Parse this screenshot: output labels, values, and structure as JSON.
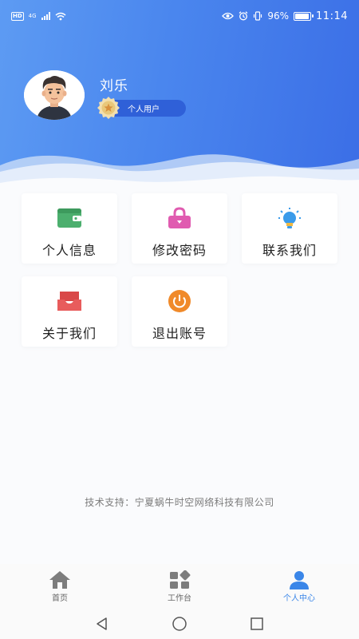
{
  "status_bar": {
    "hd": "HD",
    "network": "4G",
    "battery": "96%",
    "battery_level": 0.96,
    "time": "11:14"
  },
  "profile": {
    "name": "刘乐",
    "badge": "个人用户"
  },
  "menu": [
    {
      "label": "个人信息",
      "icon": "wallet-icon",
      "color": "#4caf6e"
    },
    {
      "label": "修改密码",
      "icon": "lock-icon",
      "color": "#e05bb0"
    },
    {
      "label": "联系我们",
      "icon": "bulb-icon",
      "color": "#3a9bea"
    },
    {
      "label": "关于我们",
      "icon": "inbox-icon",
      "color": "#e85c5c"
    },
    {
      "label": "退出账号",
      "icon": "power-icon",
      "color": "#f08a2a"
    }
  ],
  "tech_support": "技术支持：宁夏蜗牛时空网络科技有限公司",
  "tabs": [
    {
      "label": "首页",
      "icon": "home-icon",
      "active": false
    },
    {
      "label": "工作台",
      "icon": "workbench-icon",
      "active": false
    },
    {
      "label": "个人中心",
      "icon": "user-icon",
      "active": true
    }
  ],
  "colors": {
    "header_gradient_start": "#5d9bf3",
    "header_gradient_end": "#3b6ee6",
    "badge_bg": "#2f60d8",
    "active_tab": "#3a86e8"
  }
}
